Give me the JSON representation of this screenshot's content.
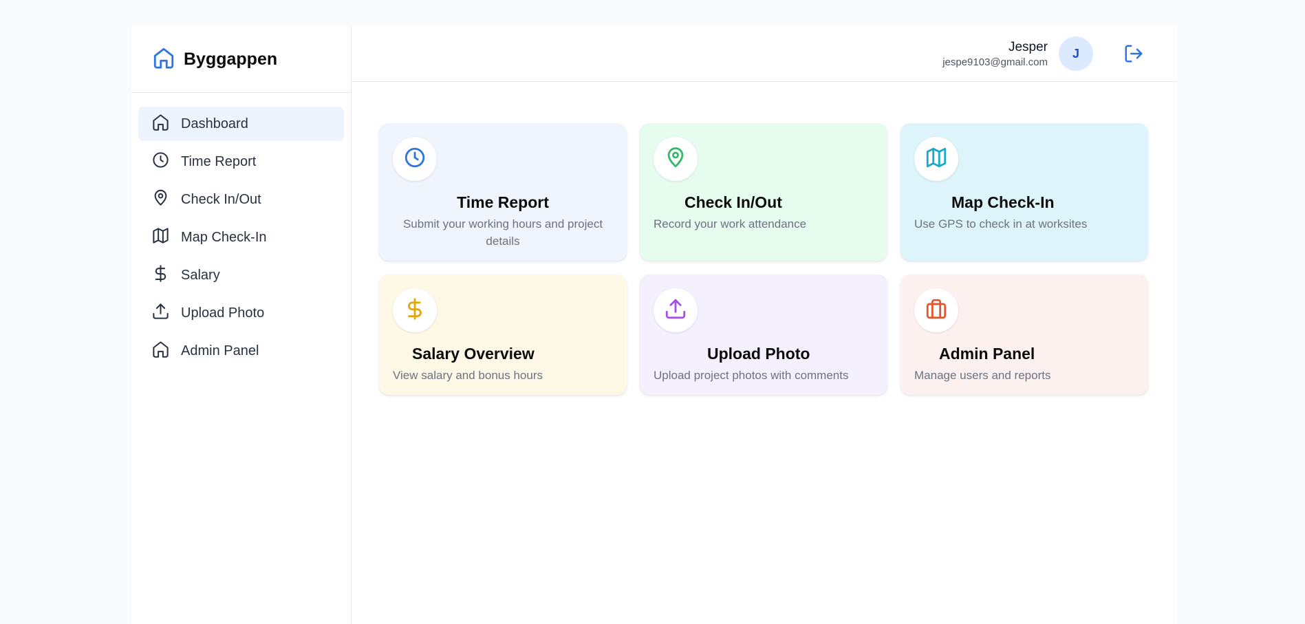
{
  "app": {
    "name": "Byggappen"
  },
  "sidebar": {
    "items": [
      {
        "label": "Dashboard",
        "icon": "home-icon",
        "active": true
      },
      {
        "label": "Time Report",
        "icon": "clock-icon"
      },
      {
        "label": "Check In/Out",
        "icon": "map-pin-icon"
      },
      {
        "label": "Map Check-In",
        "icon": "map-icon"
      },
      {
        "label": "Salary",
        "icon": "dollar-icon"
      },
      {
        "label": "Upload Photo",
        "icon": "upload-icon"
      },
      {
        "label": "Admin Panel",
        "icon": "home-icon"
      }
    ]
  },
  "header": {
    "user_name": "Jesper",
    "user_email": "jespe9103@gmail.com",
    "avatar_initial": "J"
  },
  "cards": [
    {
      "title": "Time Report",
      "description": "Submit your working hours and project details",
      "icon": "clock-icon",
      "bg": "#eff4fd",
      "color": "#2f73e0"
    },
    {
      "title": "Check In/Out",
      "description": "Record your work attendance",
      "icon": "map-pin-icon",
      "bg": "#e6fcef",
      "color": "#34b86a"
    },
    {
      "title": "Map Check-In",
      "description": "Use GPS to check in at worksites",
      "icon": "map-icon",
      "bg": "#def4fb",
      "color": "#19a9c9"
    },
    {
      "title": "Salary Overview",
      "description": "View salary and bonus hours",
      "icon": "dollar-icon",
      "bg": "#fef8e6",
      "color": "#e2a512"
    },
    {
      "title": "Upload Photo",
      "description": "Upload project photos with comments",
      "icon": "upload-icon",
      "bg": "#f4f0fd",
      "color": "#a44fe6"
    },
    {
      "title": "Admin Panel",
      "description": "Manage users and reports",
      "icon": "briefcase-icon",
      "bg": "#fdf1f0",
      "color": "#e2572d"
    }
  ]
}
